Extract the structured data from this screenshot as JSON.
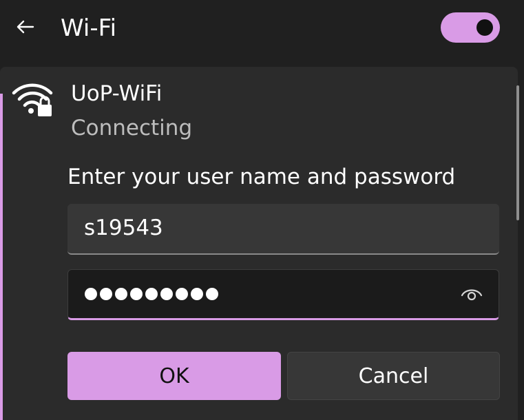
{
  "header": {
    "title": "Wi-Fi",
    "back_icon": "back-arrow-icon",
    "toggle_on": true
  },
  "network": {
    "name": "UoP-WiFi",
    "status": "Connecting",
    "icon": "secured-wifi-icon"
  },
  "login": {
    "prompt": "Enter your user name and password",
    "username_value": "s19543",
    "password_masked": "●●●●●●●●●",
    "reveal_icon": "eye-icon",
    "ok_label": "OK",
    "cancel_label": "Cancel"
  },
  "colors": {
    "accent": "#d99be6",
    "background": "#202020",
    "panel": "#2b2b2b",
    "field": "#373737",
    "password_field": "#1b1b1b"
  }
}
